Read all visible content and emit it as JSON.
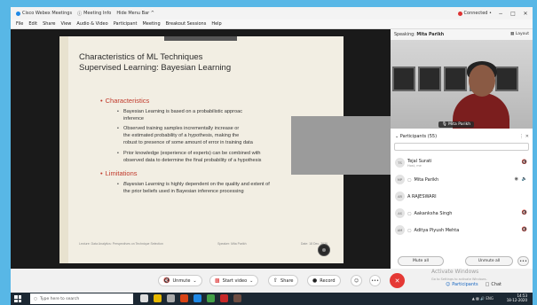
{
  "titlebar": {
    "app": "Cisco Webex Meetings",
    "meeting_info": "Meeting Info",
    "hide_menu": "Hide Menu Bar ^",
    "connected": "Connected •",
    "minimize": "−",
    "maximize": "□",
    "close": "✕"
  },
  "menu": [
    "File",
    "Edit",
    "Share",
    "View",
    "Audio & Video",
    "Participant",
    "Meeting",
    "Breakout Sessions",
    "Help"
  ],
  "slide": {
    "title_line1": "Characteristics of ML Techniques",
    "title_line2": "Supervised Learning: Bayesian Learning",
    "section1": "Characteristics",
    "points1": [
      "Bayesian Learning is based on a probabilistic approac",
      "inference",
      "Observed training samples incrementally increase or",
      "the estimated probability of a hypothesis, making the",
      "robust to presence of some amount of error in training data",
      "Prior knowledge (experience of experts) can be combined with",
      "observed data to determine the final probability of a hypothesis"
    ],
    "section2": "Limitations",
    "points2_italic": "Bayesian Learning",
    "points2": [
      " is highly dependent on the quality and extent of",
      "the prior beliefs used in Bayesian inference processing"
    ],
    "footer_left": "Lecture: Data Analytics: Perspectives on Technique Selection",
    "footer_mid": "Speaker:  Mita Parikh",
    "footer_right": "Date: 18 Dec. 2020"
  },
  "speaking": {
    "label": "Speaking:",
    "name": "Mita Parikh",
    "layout": "Layout"
  },
  "video_name": "Mita Parikh",
  "participants": {
    "header": "Participants (55)",
    "list": [
      {
        "initials": "TS",
        "name": "Tejal Surati",
        "sub": "Host, me"
      },
      {
        "initials": "MP",
        "name": "Mita Parikh",
        "sub": ""
      },
      {
        "initials": "AR",
        "name": "A RAJESWARI",
        "sub": ""
      },
      {
        "initials": "AS",
        "name": "Aakanksha Singh",
        "sub": ""
      },
      {
        "initials": "AM",
        "name": "Aditya Piyush Mehta",
        "sub": ""
      }
    ],
    "mute_all": "Mute all",
    "unmute_all": "Unmute all",
    "more": "•••"
  },
  "controls": {
    "unmute": "Unmute",
    "start_video": "Start video",
    "share": "Share",
    "record": "Record",
    "more": "•••",
    "end": "✕",
    "participants": "Participants",
    "chat": "Chat"
  },
  "watermark": {
    "line1": "Activate Windows",
    "line2": "Go to Settings to activate Windows."
  },
  "taskbar": {
    "search": "Type here to search",
    "time": "14:53",
    "date": "18-12-2020",
    "lang": "ENG"
  }
}
